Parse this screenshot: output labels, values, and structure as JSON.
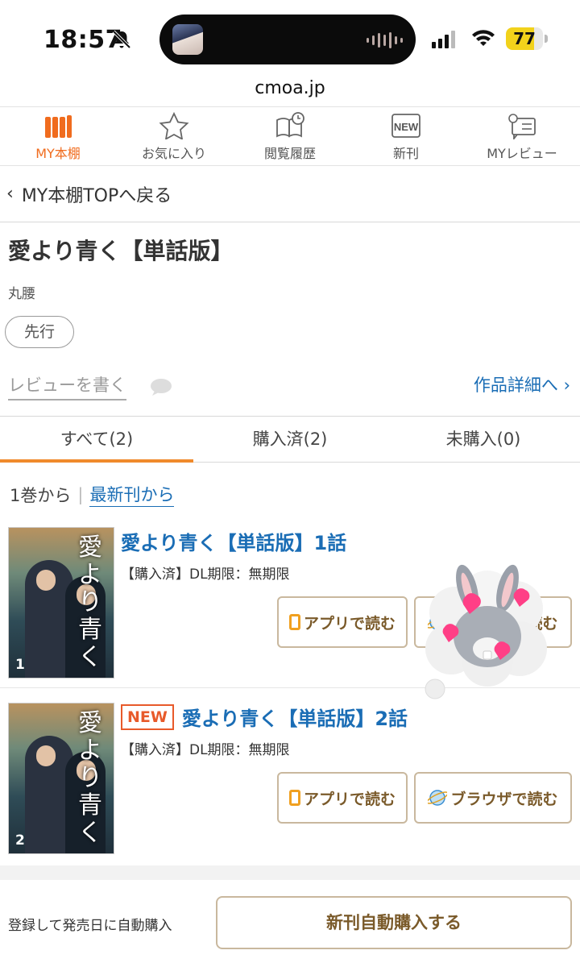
{
  "status": {
    "time": "18:57",
    "battery": "77",
    "battery_level": 0.77
  },
  "browser": {
    "url": "cmoa.jp"
  },
  "nav": [
    {
      "label": "MY本棚",
      "icon": "bookshelf-icon",
      "active": true
    },
    {
      "label": "お気に入り",
      "icon": "star-icon"
    },
    {
      "label": "閲覧履歴",
      "icon": "history-book-icon"
    },
    {
      "label": "新刊",
      "icon": "new-badge-icon"
    },
    {
      "label": "MYレビュー",
      "icon": "review-icon"
    }
  ],
  "back": {
    "label": "MY本棚TOPへ戻る"
  },
  "work": {
    "title": "愛より青く【単話版】",
    "author": "丸腰",
    "tag": "先行"
  },
  "review": {
    "write_label": "レビューを書く",
    "detail_label": "作品詳細へ"
  },
  "tabs": [
    {
      "label": "すべて(2)",
      "active": true
    },
    {
      "label": "購入済(2)"
    },
    {
      "label": "未購入(0)"
    }
  ],
  "sort": {
    "from_first": "1巻から",
    "from_latest": "最新刊から"
  },
  "volumes": [
    {
      "title": "愛より青く【単話版】1話",
      "status": "【購入済】DL期限：無期限",
      "cover_title": "愛より青く",
      "cover_num": "1",
      "app_button": "アプリで読む",
      "browser_button": "ブラウザで読む",
      "is_new": false
    },
    {
      "title": "愛より青く【単話版】2話",
      "status": "【購入済】DL期限：無期限",
      "cover_title": "愛より青く",
      "cover_num": "2",
      "app_button": "アプリで読む",
      "browser_button": "ブラウザで読む",
      "is_new": true,
      "new_label": "NEW"
    }
  ],
  "footer": {
    "text": "登録して発売日に自動購入",
    "button": "新刊自動購入する"
  },
  "colors": {
    "accent_orange": "#f06c1e",
    "link_blue": "#1a6db5",
    "button_brown": "#7a5a2a"
  }
}
